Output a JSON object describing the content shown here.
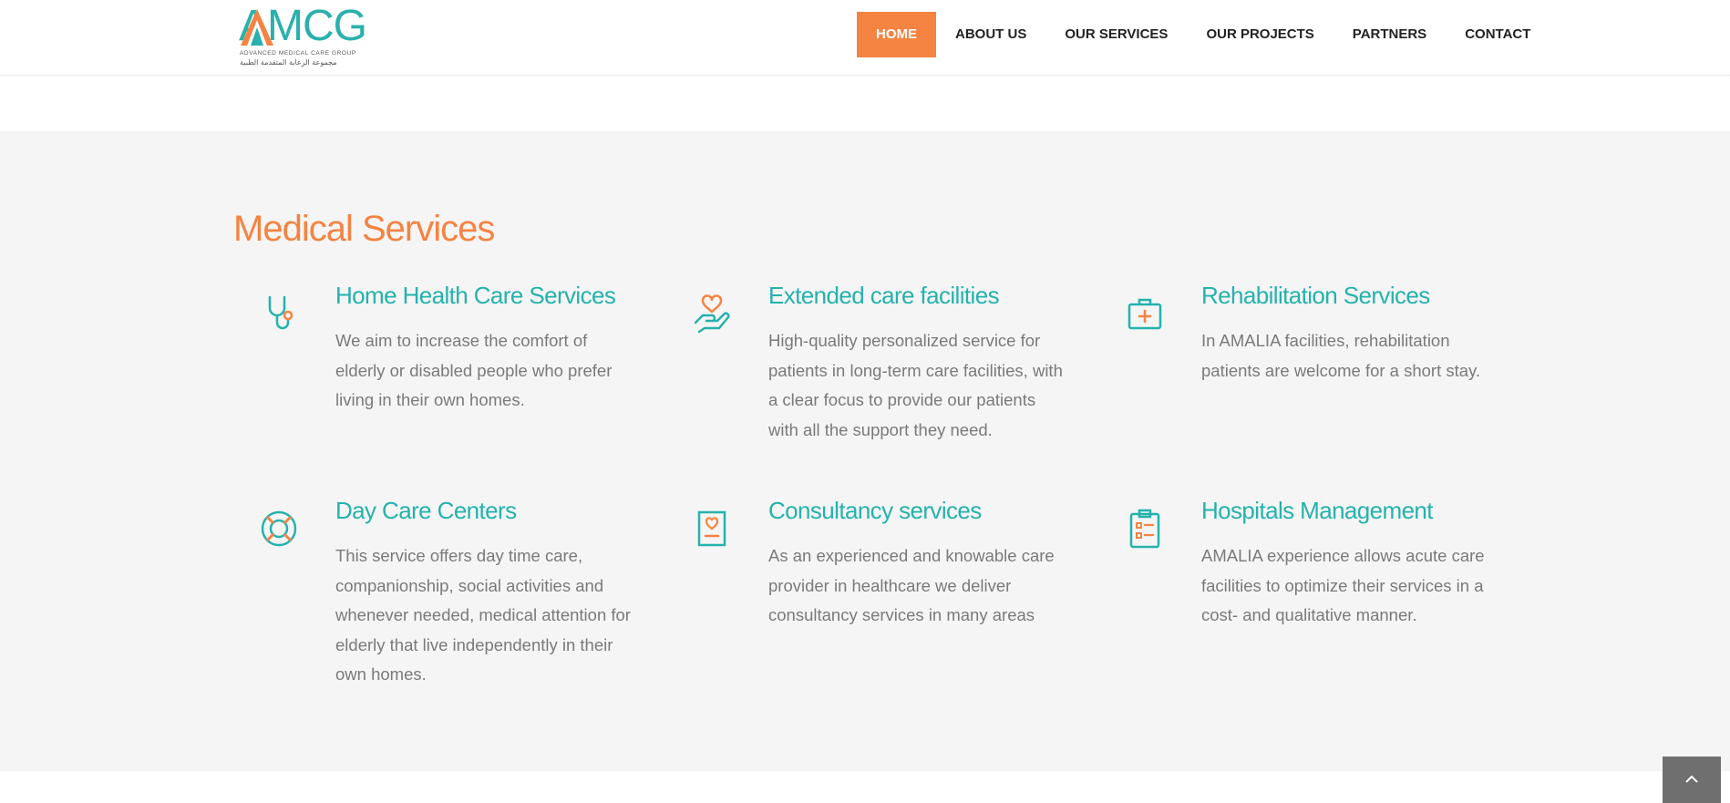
{
  "header": {
    "logo": {
      "text": "AMCG",
      "subtitle": "ADVANCED MEDICAL CARE GROUP",
      "arabic": "مجموعة الرعاية المتقدمة الطبية"
    },
    "nav": [
      {
        "label": "HOME",
        "active": true
      },
      {
        "label": "ABOUT US",
        "active": false
      },
      {
        "label": "OUR SERVICES",
        "active": false
      },
      {
        "label": "OUR PROJECTS",
        "active": false
      },
      {
        "label": "PARTNERS",
        "active": false
      },
      {
        "label": "CONTACT",
        "active": false
      }
    ]
  },
  "section": {
    "title": "Medical Services",
    "services": [
      {
        "icon": "stethoscope-icon",
        "title": "Home Health Care Services",
        "text": "We aim to increase the comfort of elderly or disabled people who prefer living in their own homes."
      },
      {
        "icon": "heart-in-hand-icon",
        "title": "Extended care facilities",
        "text": "High-quality personalized service for patients in long-term care facilities, with a clear focus to provide our patients with all the support they need."
      },
      {
        "icon": "first-aid-kit-icon",
        "title": "Rehabilitation Services",
        "text": "In AMALIA facilities, rehabilitation patients are welcome for a short stay."
      },
      {
        "icon": "lifebuoy-icon",
        "title": "Day Care Centers",
        "text": "This service offers day time care, companionship, social activities and whenever needed, medical attention for elderly that live independently in their own homes."
      },
      {
        "icon": "heart-document-icon",
        "title": "Consultancy services",
        "text": "As an experienced and knowable care provider in healthcare we deliver consultancy services in many areas"
      },
      {
        "icon": "clipboard-icon",
        "title": "Hospitals Management",
        "text": "AMALIA experience allows acute care facilities to optimize their services in a cost- and qualitative manner."
      }
    ]
  },
  "colors": {
    "accent": "#f58342",
    "teal": "#25b2ad",
    "section_bg": "#f5f5f5",
    "body_text": "#7a7a7a"
  }
}
